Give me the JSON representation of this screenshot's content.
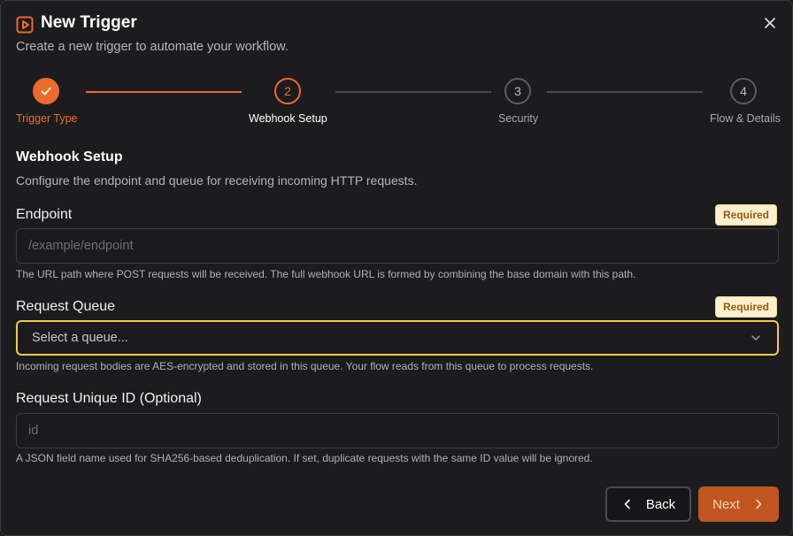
{
  "dialog": {
    "title": "New Trigger",
    "subtitle": "Create a new trigger to automate your workflow.",
    "icons": {
      "header": "play-square-icon",
      "close": "close-icon"
    }
  },
  "stepper": {
    "steps": [
      {
        "label": "Trigger Type",
        "number": "",
        "state": "completed"
      },
      {
        "label": "Webhook Setup",
        "number": "2",
        "state": "active"
      },
      {
        "label": "Security",
        "number": "3",
        "state": "upcoming"
      },
      {
        "label": "Flow & Details",
        "number": "4",
        "state": "upcoming"
      }
    ]
  },
  "section": {
    "title": "Webhook Setup",
    "description": "Configure the endpoint and queue for receiving incoming HTTP requests."
  },
  "fields": {
    "endpoint": {
      "label": "Endpoint",
      "badge": "Required",
      "placeholder": "/example/endpoint",
      "help": "The URL path where POST requests will be received. The full webhook URL is formed by combining the base domain with this path."
    },
    "queue": {
      "label": "Request Queue",
      "badge": "Required",
      "selected": "Select a queue...",
      "help": "Incoming request bodies are AES-encrypted and stored in this queue. Your flow reads from this queue to process requests."
    },
    "unique_id": {
      "label": "Request Unique ID (Optional)",
      "placeholder": "id",
      "help": "A JSON field name used for SHA256-based deduplication. If set, duplicate requests with the same ID value will be ignored."
    }
  },
  "footer": {
    "back_label": "Back",
    "next_label": "Next"
  },
  "colors": {
    "accent": "#ee6a2b",
    "required_badge_bg": "#fdf0cf",
    "focus_border": "#f2c94c"
  }
}
